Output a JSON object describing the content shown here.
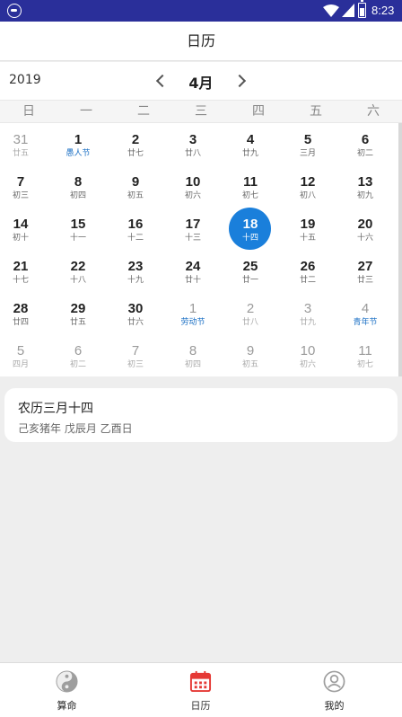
{
  "status": {
    "time": "8:23"
  },
  "header": {
    "title": "日历"
  },
  "month_nav": {
    "year": "2019",
    "month": "4月"
  },
  "weekdays": [
    "日",
    "一",
    "二",
    "三",
    "四",
    "五",
    "六"
  ],
  "weeks": [
    [
      {
        "d": "31",
        "l": "廿五",
        "o": true
      },
      {
        "d": "1",
        "l": "愚人节",
        "f": true
      },
      {
        "d": "2",
        "l": "廿七"
      },
      {
        "d": "3",
        "l": "廿八"
      },
      {
        "d": "4",
        "l": "廿九"
      },
      {
        "d": "5",
        "l": "三月"
      },
      {
        "d": "6",
        "l": "初二"
      }
    ],
    [
      {
        "d": "7",
        "l": "初三"
      },
      {
        "d": "8",
        "l": "初四"
      },
      {
        "d": "9",
        "l": "初五"
      },
      {
        "d": "10",
        "l": "初六"
      },
      {
        "d": "11",
        "l": "初七"
      },
      {
        "d": "12",
        "l": "初八"
      },
      {
        "d": "13",
        "l": "初九"
      }
    ],
    [
      {
        "d": "14",
        "l": "初十"
      },
      {
        "d": "15",
        "l": "十一"
      },
      {
        "d": "16",
        "l": "十二"
      },
      {
        "d": "17",
        "l": "十三"
      },
      {
        "d": "18",
        "l": "十四",
        "s": true
      },
      {
        "d": "19",
        "l": "十五"
      },
      {
        "d": "20",
        "l": "十六"
      }
    ],
    [
      {
        "d": "21",
        "l": "十七"
      },
      {
        "d": "22",
        "l": "十八"
      },
      {
        "d": "23",
        "l": "十九"
      },
      {
        "d": "24",
        "l": "廿十"
      },
      {
        "d": "25",
        "l": "廿一"
      },
      {
        "d": "26",
        "l": "廿二"
      },
      {
        "d": "27",
        "l": "廿三"
      }
    ],
    [
      {
        "d": "28",
        "l": "廿四"
      },
      {
        "d": "29",
        "l": "廿五"
      },
      {
        "d": "30",
        "l": "廿六"
      },
      {
        "d": "1",
        "l": "劳动节",
        "o": true,
        "f": true
      },
      {
        "d": "2",
        "l": "廿八",
        "o": true
      },
      {
        "d": "3",
        "l": "廿九",
        "o": true
      },
      {
        "d": "4",
        "l": "青年节",
        "o": true,
        "f": true
      }
    ],
    [
      {
        "d": "5",
        "l": "四月",
        "o": true
      },
      {
        "d": "6",
        "l": "初二",
        "o": true
      },
      {
        "d": "7",
        "l": "初三",
        "o": true
      },
      {
        "d": "8",
        "l": "初四",
        "o": true
      },
      {
        "d": "9",
        "l": "初五",
        "o": true
      },
      {
        "d": "10",
        "l": "初六",
        "o": true
      },
      {
        "d": "11",
        "l": "初七",
        "o": true
      }
    ]
  ],
  "info": {
    "lunar_date": "农历三月十四",
    "ganzhi": "己亥猪年  戊辰月  乙酉日"
  },
  "bottom_nav": [
    {
      "label": "算命",
      "icon": "yin-yang-icon"
    },
    {
      "label": "日历",
      "icon": "calendar-icon",
      "active": true
    },
    {
      "label": "我的",
      "icon": "profile-icon"
    }
  ],
  "colors": {
    "status_bar": "#2a2f9a",
    "accent": "#1a7fdb",
    "festival": "#1a6fc4",
    "nav_active": "#e53935"
  }
}
